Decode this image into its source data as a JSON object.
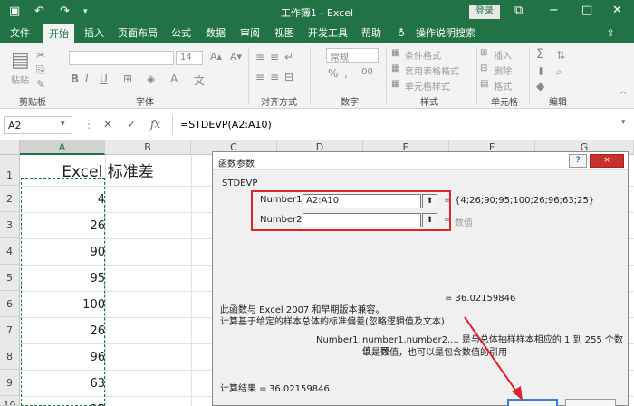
{
  "window": {
    "title": "工作簿1 - Excel",
    "login_label": "登录",
    "undo_icon": "undo-icon",
    "redo_icon": "redo-icon",
    "save_icon": "save-icon",
    "minimize_icon": "minimize-icon",
    "restore_icon": "restore-icon",
    "close_icon": "close-icon"
  },
  "ribbon": {
    "tabs": [
      "文件",
      "开始",
      "插入",
      "页面布局",
      "公式",
      "数据",
      "审阅",
      "视图",
      "开发工具",
      "帮助"
    ],
    "active_tab": "开始",
    "tell_me": "操作说明搜索",
    "groups": [
      "剪贴板",
      "字体",
      "对齐方式",
      "数字",
      "样式",
      "单元格",
      "编辑"
    ],
    "paste_label": "粘贴",
    "font_size": "14",
    "number_format": "常规",
    "style_items": [
      "条件格式",
      "套用表格格式",
      "单元格样式"
    ],
    "cell_items": [
      "插入",
      "删除",
      "格式"
    ],
    "accent_color": "#217346"
  },
  "formula_bar": {
    "name_box": "A2",
    "cancel_icon": "x-icon",
    "confirm_icon": "check-icon",
    "fx_label": "fx",
    "formula": "=STDEVP(A2:A10)"
  },
  "sheet": {
    "columns": [
      "A",
      "B",
      "C",
      "D",
      "E",
      "F",
      "G"
    ],
    "rows": [
      "1",
      "2",
      "3",
      "4",
      "5",
      "6",
      "7",
      "8",
      "9",
      "10"
    ],
    "a1_title": "Excel 标准差",
    "a_values": [
      "4",
      "26",
      "90",
      "95",
      "100",
      "26",
      "96",
      "63",
      "25"
    ]
  },
  "dialog": {
    "title": "函数参数",
    "help_label": "?",
    "close_label": "×",
    "function_name": "STDEVP",
    "args": [
      {
        "label": "Number1",
        "value": "A2:A10",
        "result": "{4;26;90;95;100;26;96;63;25}"
      },
      {
        "label": "Number2",
        "value": "",
        "result": "数值"
      }
    ],
    "eq_sign": "=",
    "formula_result_line": "=   36.02159846",
    "desc_line1": "此函数与 Excel 2007 和早期版本兼容。",
    "desc_line2": "计算基于给定的样本总体的标准偏差(忽略逻辑值及文本)",
    "param_label": "Number1:",
    "param_desc1": "number1,number2,... 是与总体抽样样本相应的 1 到 255 个数值，可",
    "param_desc2": "以是数值，也可以是包含数值的引用",
    "result_label": "计算结果 =",
    "result_value": "36.02159846",
    "highlight_color": "#d9262c"
  }
}
